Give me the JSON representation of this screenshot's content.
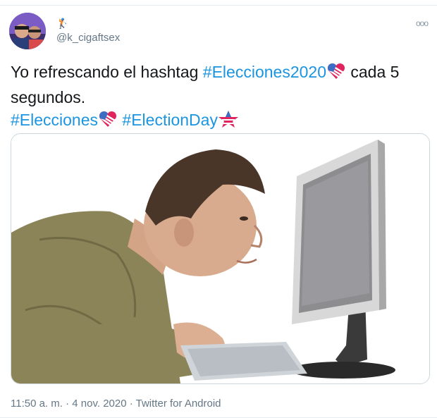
{
  "user": {
    "name_glyph": "🏌",
    "handle": "@k_cigaftsex",
    "avatar_icon": "avatar-photo"
  },
  "menu": {
    "icon": "more-dots-icon",
    "glyph": "ooo"
  },
  "tweet": {
    "text_part1": "Yo refrescando el hashtag ",
    "hashtag1": "#Elecciones2020",
    "text_part2": " cada 5 segundos.",
    "hashtag2": "#Elecciones",
    "hashtag3": "#ElectionDay"
  },
  "media": {
    "description_icon": "man-staring-at-monitor-photo"
  },
  "footer": {
    "time": "11:50 a. m.",
    "separator": " · ",
    "date": "4 nov. 2020",
    "source": "Twitter for Android"
  },
  "colors": {
    "link": "#1b95e0",
    "secondary_text": "#657786",
    "border": "#ccd6dd"
  }
}
